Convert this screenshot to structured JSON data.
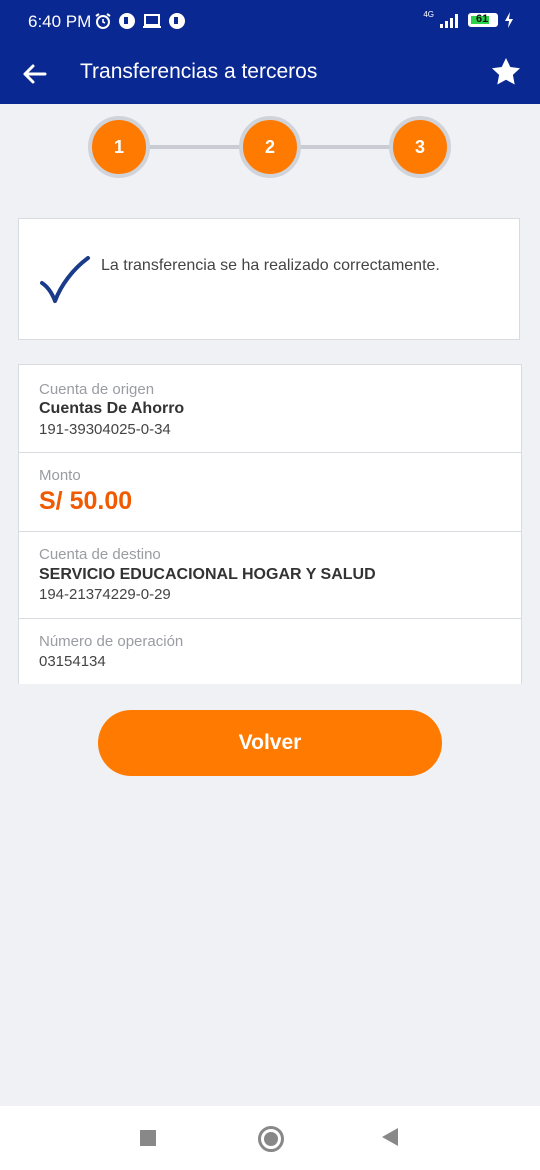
{
  "status_bar": {
    "time": "6:40 PM",
    "network": "4G",
    "battery": "61"
  },
  "header": {
    "title": "Transferencias a terceros",
    "back_icon": "arrow-left-icon",
    "favorite_icon": "star-icon"
  },
  "stepper": {
    "steps": [
      "1",
      "2",
      "3"
    ]
  },
  "success": {
    "icon": "check-icon",
    "message": "La transferencia se ha realizado correctamente."
  },
  "details": {
    "origin": {
      "label": "Cuenta de origen",
      "name": "Cuentas De Ahorro",
      "number": "191-39304025-0-34"
    },
    "amount": {
      "label": "Monto",
      "value": "S/ 50.00"
    },
    "destination": {
      "label": "Cuenta de destino",
      "name": "SERVICIO EDUCACIONAL HOGAR Y SALUD",
      "number": "194-21374229-0-29"
    },
    "operation": {
      "label": "Número de operación",
      "value": "03154134"
    }
  },
  "actions": {
    "back_label": "Volver"
  },
  "colors": {
    "brand_blue": "#0a2891",
    "accent_orange": "#ff7a00",
    "amount_orange": "#f05a00"
  }
}
